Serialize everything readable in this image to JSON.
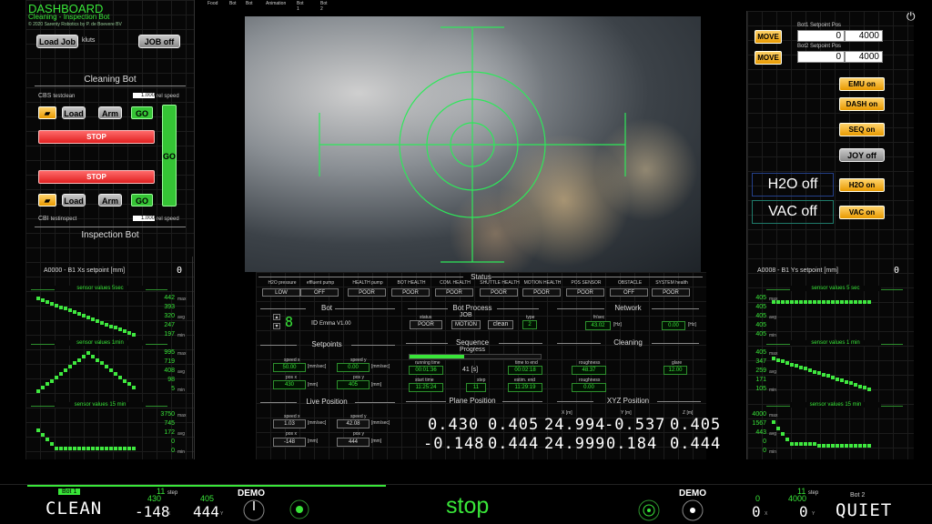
{
  "app": {
    "title": "DASHBOARD",
    "subtitle": "Cleaning - Inspection Bot",
    "copyright": "© 2020 Sarenty Robotics by P. de Boevere BV"
  },
  "topnav": [
    "Food",
    "Bot",
    "Bot",
    "Animation",
    "Bot 1",
    "Bot 2"
  ],
  "left": {
    "load_job": "Load Job",
    "job_name": "kluts",
    "job_off": "JOB off",
    "cleaning_title": "Cleaning Bot",
    "cbs_label": "CBS",
    "cbs_name": "testclean",
    "cbs_speed": "1.000",
    "speed_label": "rel speed",
    "load": "Load",
    "arm": "Arm",
    "go": "GO",
    "stop": "STOP",
    "go_big": "GO",
    "cbi_label": "CBI",
    "cbi_name": "testinspect",
    "cbi_speed": "1.000",
    "inspection_title": "Inspection Bot",
    "setpoint_label": "A0000 - B1 Xs setpoint [mm]",
    "setpoint_val": "0",
    "charts": [
      {
        "title": "sensor values 5sec",
        "vals": [
          "442",
          "393",
          "320",
          "247",
          "197"
        ],
        "subs": [
          "max",
          "",
          "avg",
          "",
          "min"
        ]
      },
      {
        "title": "sensor values 1min",
        "vals": [
          "995",
          "719",
          "408",
          "98",
          "5"
        ],
        "subs": [
          "max",
          "",
          "avg",
          "",
          "min"
        ]
      },
      {
        "title": "sensor values 15 min",
        "vals": [
          "3750",
          "745",
          "172",
          "0",
          "0"
        ],
        "subs": [
          "max",
          "",
          "avg",
          "",
          "min"
        ]
      }
    ]
  },
  "right": {
    "move": "MOVE",
    "bot1_sp": "Bot1 Setpoint Pos",
    "bot2_sp": "Bot2 Setpoint Pos",
    "bot1_a": "0",
    "bot1_b": "4000",
    "bot2_a": "0",
    "bot2_b": "4000",
    "emu": "EMU on",
    "dash": "DASH on",
    "seq": "SEQ on",
    "joy": "JOY off",
    "h2o_status": "H2O off",
    "h2o_btn": "H2O on",
    "vac_status": "VAC off",
    "vac_btn": "VAC on",
    "setpoint_label": "A0008 - B1 Ys setpoint [mm]",
    "setpoint_val": "0",
    "charts": [
      {
        "title": "sensor values 5 sec",
        "vals": [
          "405",
          "405",
          "405",
          "405",
          "405"
        ],
        "subs": [
          "max",
          "",
          "avg",
          "",
          "min"
        ]
      },
      {
        "title": "sensor values 1 min",
        "vals": [
          "405",
          "347",
          "259",
          "171",
          "105"
        ],
        "subs": [
          "max",
          "",
          "avg",
          "",
          "min"
        ]
      },
      {
        "title": "sensor values 15 min",
        "vals": [
          "4000",
          "1567",
          "443",
          "0",
          "0"
        ],
        "subs": [
          "max",
          "",
          "avg",
          "",
          "min"
        ]
      }
    ]
  },
  "status": {
    "title": "Status",
    "items": [
      {
        "label": "H2O pressure",
        "value": "LOW"
      },
      {
        "label": "effluent pump",
        "value": "OFF"
      },
      {
        "label": "HEALTH pump",
        "value": "POOR"
      },
      {
        "label": "BOT HEALTH",
        "value": "POOR"
      },
      {
        "label": "COM. HEALTH",
        "value": "POOR"
      },
      {
        "label": "SHUTTLE HEALTH",
        "value": "POOR"
      },
      {
        "label": "MOTION HEALTH",
        "value": "POOR"
      },
      {
        "label": "POS SENSOR",
        "value": "POOR"
      },
      {
        "label": "OBSTACLE",
        "value": "OFF"
      },
      {
        "label": "SYSTEM health",
        "value": "POOR"
      }
    ]
  },
  "bot": {
    "title": "Bot",
    "id_text": "ID",
    "name": "Emma V1.00"
  },
  "process": {
    "title": "Bot Process",
    "job": "JOB",
    "status_lbl": "status",
    "type_lbl": "type",
    "status": "POOR",
    "motion": "MOTION",
    "clean": "clean",
    "type": "2"
  },
  "network": {
    "title": "Network",
    "fr_lbl": "fr/sec",
    "val1": "43.02",
    "u1": "[Hz]",
    "val2": "0.00",
    "u2": "[Hz]"
  },
  "setpoints": {
    "title": "Setpoints",
    "speed_x_lbl": "speed x",
    "speed_y_lbl": "speed y",
    "speed_x": "50.00",
    "speed_y": "0.00",
    "unit_speed": "[mm/sec]",
    "pos_x_lbl": "pos x",
    "pos_y_lbl": "pos y",
    "pos_x": "430",
    "pos_y": "405",
    "unit_pos": "[mm]"
  },
  "sequence": {
    "title": "Sequence",
    "progress_lbl": "Progress",
    "progress": 0.42,
    "run_lbl": "running time",
    "run": "00:01:36",
    "pct": "41 [s]",
    "end_lbl": "time to end",
    "end": "00:02:18",
    "start_lbl": "start time",
    "start": "11:25:24",
    "step_lbl": "step",
    "step": "11",
    "comp_lbl": "estim. end",
    "comp": "11:29:19"
  },
  "cleaning": {
    "title": "Cleaning",
    "rough_lbl": "roughness",
    "rough": "48.37",
    "glare_lbl": "glare",
    "glare": "12.00",
    "rough2_lbl": "roughness",
    "rough2": "0.00"
  },
  "live": {
    "title": "Live Position",
    "speed_x_lbl": "speed x",
    "speed_y_lbl": "speed y",
    "speed_x": "1.03",
    "speed_y": "42.08",
    "unit_speed": "[mm/sec]",
    "pos_x_lbl": "pos x",
    "pos_y_lbl": "pos y",
    "pos_x": "-148",
    "pos_y": "444",
    "unit_pos": "[mm]"
  },
  "plane": {
    "title": "Plane Position",
    "r1": [
      "0.430",
      "0.405"
    ],
    "r2": [
      "-0.148",
      "0.444"
    ]
  },
  "xyz": {
    "title": "XYZ Position",
    "x_lbl": "X [m]",
    "y_lbl": "Y [m]",
    "z_lbl": "Z [m]",
    "r1": [
      "24.994",
      "-0.537",
      "0.405"
    ],
    "r2": [
      "24.999",
      "0.184",
      "0.444"
    ]
  },
  "bottom": {
    "bot1": "Bot 1",
    "mode1": "CLEAN",
    "step_n": "11",
    "step_lbl": "step",
    "x1": "-148",
    "x1_top": "430",
    "y1": "444",
    "y1_top": "405",
    "demo": "DEMO",
    "stop": "stop",
    "demo2": "DEMO",
    "x2": "0",
    "x2_top": "0",
    "step2_n": "11",
    "y2": "0",
    "y2_top": "4000",
    "bot2": "Bot 2",
    "mode2": "QUIET",
    "x_sub": "X",
    "y_sub": "Y"
  },
  "colors": {
    "accent": "#39e639",
    "warn": "#e89a00",
    "danger": "#e02020"
  }
}
